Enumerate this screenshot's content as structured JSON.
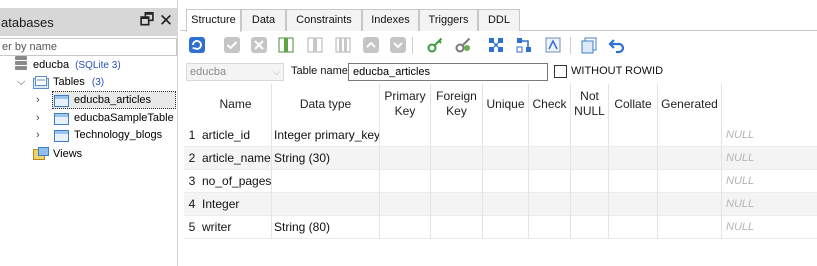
{
  "sidebar": {
    "title": "atabases",
    "filter_placeholder": "er by name",
    "db_name": "educba",
    "db_type": "(SQLite 3)",
    "tables_label": "Tables",
    "tables_count": "(3)",
    "tables": [
      "educba_articles",
      "educbaSampleTable",
      "Technology_blogs"
    ],
    "views_label": "Views"
  },
  "tabs": [
    "Structure",
    "Data",
    "Constraints",
    "Indexes",
    "Triggers",
    "DDL"
  ],
  "namebar": {
    "schema": "educba",
    "table_name_label": "Table name:",
    "table_name": "educba_articles",
    "without_rowid": "WITHOUT ROWID"
  },
  "grid": {
    "headers": [
      "Name",
      "Data type",
      "Primary\nKey",
      "Foreign\nKey",
      "Unique",
      "Check",
      "Not\nNULL",
      "Collate",
      "Generated"
    ],
    "rows": [
      {
        "num": "1",
        "name": "article_id",
        "type": "Integer primary_key",
        "default": "NULL"
      },
      {
        "num": "2",
        "name": "article_name",
        "type": "String (30)",
        "default": "NULL"
      },
      {
        "num": "3",
        "name": "no_of_pages",
        "type": "",
        "default": "NULL"
      },
      {
        "num": "4",
        "name": "Integer",
        "type": "",
        "default": "NULL"
      },
      {
        "num": "5",
        "name": "writer",
        "type": "String (80)",
        "default": "NULL"
      }
    ]
  },
  "colors": {
    "accent": "#2a52be",
    "selection": "#e9e9e9",
    "header": "#d7d7d7"
  }
}
